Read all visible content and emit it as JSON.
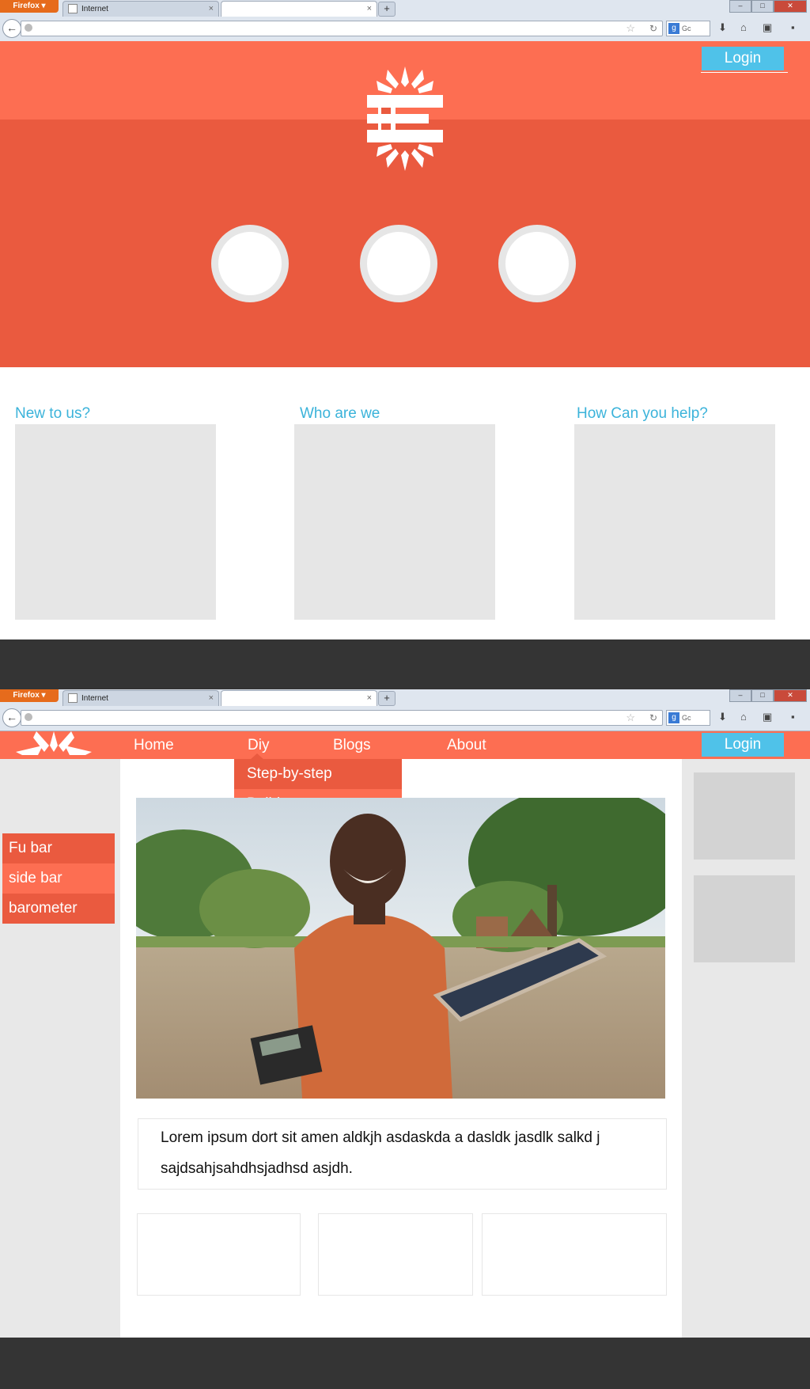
{
  "browser": {
    "firefox_label": "Firefox",
    "tab_label": "Internet",
    "search_engine_label": "Gc",
    "new_tab_label": "+",
    "tab_close_label": "×"
  },
  "screen1": {
    "login_label": "Login",
    "sections": [
      {
        "title": "New to us?"
      },
      {
        "title": "Who are we"
      },
      {
        "title": "How Can you help?"
      }
    ]
  },
  "screen2": {
    "nav": {
      "items": [
        "Home",
        "Diy",
        "Blogs",
        "About"
      ],
      "login_label": "Login"
    },
    "dropdown": [
      "Step-by-step",
      "Builds"
    ],
    "sidebar": [
      "Fu bar",
      "side bar",
      "barometer"
    ],
    "article_text": "Lorem ipsum dort sit amen aldkjh asdaskda a dasldk jasdlk salkd j sajdsahjsahdhsjadhsd asjdh."
  },
  "colors": {
    "accent_light": "#fd6e52",
    "accent_dark": "#ea5a3f",
    "login_blue": "#4fc2e9",
    "heading_blue": "#3bb3da",
    "placeholder_gray": "#e6e6e6",
    "footer_dark": "#343434"
  }
}
